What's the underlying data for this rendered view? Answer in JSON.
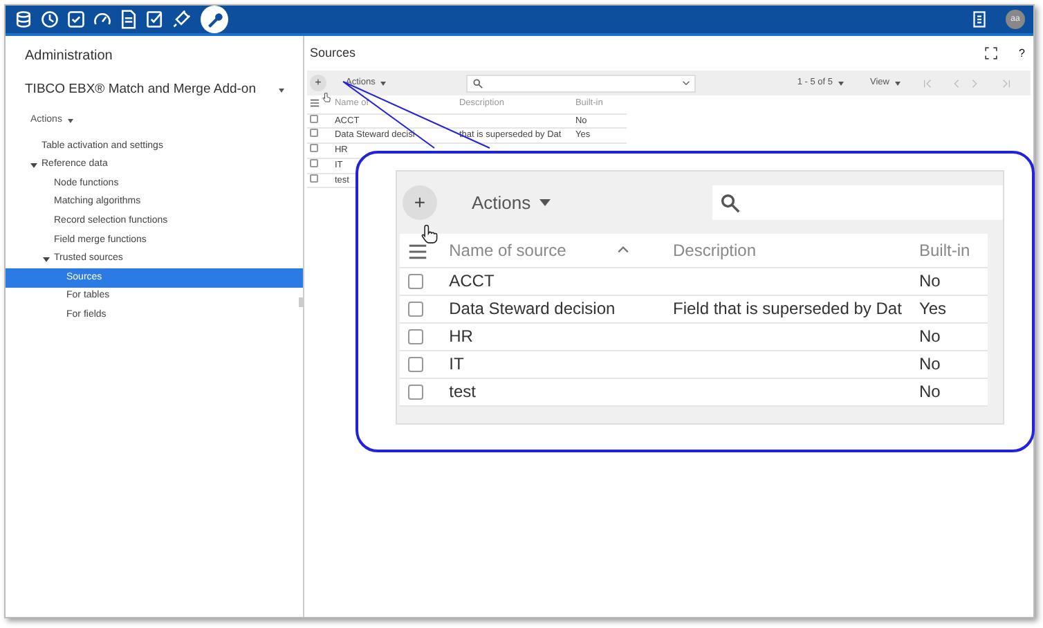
{
  "top_bar": {
    "avatar": "aa"
  },
  "left_panel": {
    "title": "Administration",
    "dataspace": "TIBCO EBX® Match and Merge Add-on",
    "actions": "Actions",
    "tree": [
      {
        "label": "Table activation and settings",
        "selected": false
      },
      {
        "label": "Reference data",
        "selected": false,
        "expanded": true,
        "children": [
          {
            "label": "Node functions",
            "selected": false
          },
          {
            "label": "Matching algorithms",
            "selected": false
          },
          {
            "label": "Record selection functions",
            "selected": false
          },
          {
            "label": "Field merge functions",
            "selected": false
          },
          {
            "label": "Trusted sources",
            "selected": false,
            "expanded": true,
            "children": [
              {
                "label": "Sources",
                "selected": true
              },
              {
                "label": "For tables",
                "selected": false
              },
              {
                "label": "For fields",
                "selected": false
              }
            ]
          }
        ]
      }
    ]
  },
  "main": {
    "title": "Sources",
    "help": "?",
    "toolbar": {
      "add": "+",
      "actions": "Actions",
      "pager": "1 - 5 of 5",
      "view": "View"
    },
    "table": {
      "columns": [
        "Name of",
        "Description",
        "Built-in"
      ],
      "rows": [
        {
          "checked": false,
          "name": "ACCT",
          "built_in": "No"
        },
        {
          "checked": false,
          "name": "Data Steward decisi",
          "description": "that is superseded by Dat",
          "built_in": "Yes"
        },
        {
          "checked": false,
          "name": "HR"
        },
        {
          "checked": false,
          "name": "IT"
        },
        {
          "checked": false,
          "name": "test"
        }
      ]
    }
  },
  "callout": {
    "toolbar": {
      "add": "+",
      "actions": "Actions"
    },
    "table": {
      "columns": [
        "Name of source",
        "Description",
        "Built-in"
      ],
      "rows": [
        {
          "checked": false,
          "name": "ACCT",
          "built_in": "No"
        },
        {
          "checked": false,
          "name": "Data Steward decision",
          "description": "Field that is superseded by Dat",
          "built_in": "Yes"
        },
        {
          "checked": false,
          "name": "HR",
          "built_in": "No"
        },
        {
          "checked": false,
          "name": "IT",
          "built_in": "No"
        },
        {
          "checked": false,
          "name": "test",
          "built_in": "No"
        }
      ]
    }
  }
}
